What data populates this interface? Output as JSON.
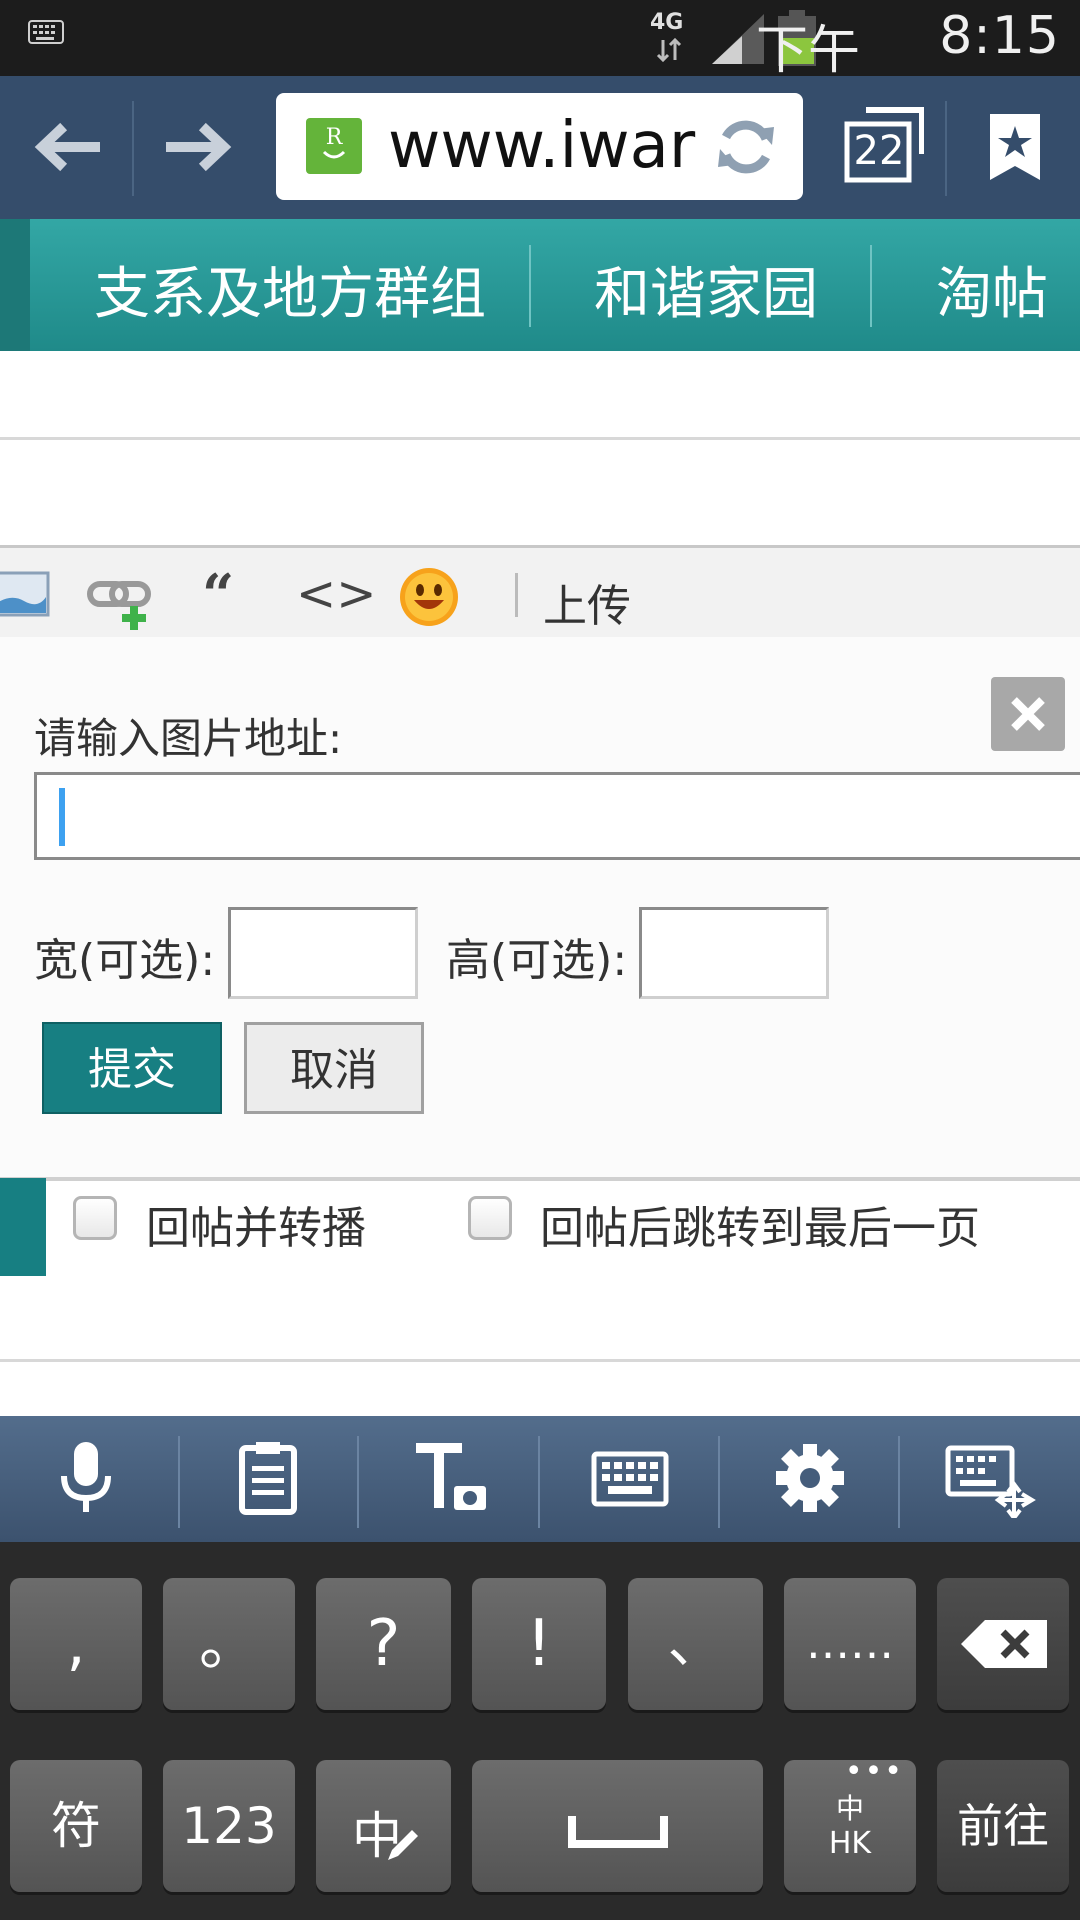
{
  "status_bar": {
    "network": "4G",
    "ampm": "下午",
    "time": "8:15",
    "battery_color": "#8cc63e"
  },
  "browser": {
    "url": "www.iwar",
    "tab_count": "22",
    "icons": [
      "back-arrow-icon",
      "forward-arrow-icon",
      "site-favicon",
      "reload-icon",
      "tabs-icon",
      "bookmark-icon"
    ]
  },
  "nav": {
    "items": [
      "支系及地方群组",
      "和谐家园",
      "淘帖"
    ],
    "color": "#2a9d9b"
  },
  "editor_toolbar": {
    "upload_label": "上传",
    "icons": [
      "image-icon",
      "link-icon",
      "quote-icon",
      "code-icon",
      "smiley-icon"
    ]
  },
  "dialog": {
    "title": "请输入图片地址:",
    "url_value": "",
    "width_label": "宽(可选):",
    "height_label": "高(可选):",
    "width_value": "",
    "height_value": "",
    "submit_label": "提交",
    "cancel_label": "取消",
    "close_glyph": "✕"
  },
  "options": {
    "repost_label": "回帖并转播",
    "jump_last_label": "回帖后跳转到最后一页",
    "repost_checked": false,
    "jump_last_checked": false
  },
  "keyboard": {
    "tool_icons": [
      "microphone-icon",
      "clipboard-icon",
      "text-ocr-icon",
      "keyboard-icon",
      "settings-gear-icon",
      "keyboard-resize-icon"
    ],
    "row1": [
      ",",
      "。",
      "?",
      "!",
      "、",
      "……"
    ],
    "row2": {
      "symbols": "符",
      "numbers": "123",
      "chinese": "中",
      "lang_top": "中",
      "lang_bottom": "HK",
      "go": "前往"
    }
  }
}
